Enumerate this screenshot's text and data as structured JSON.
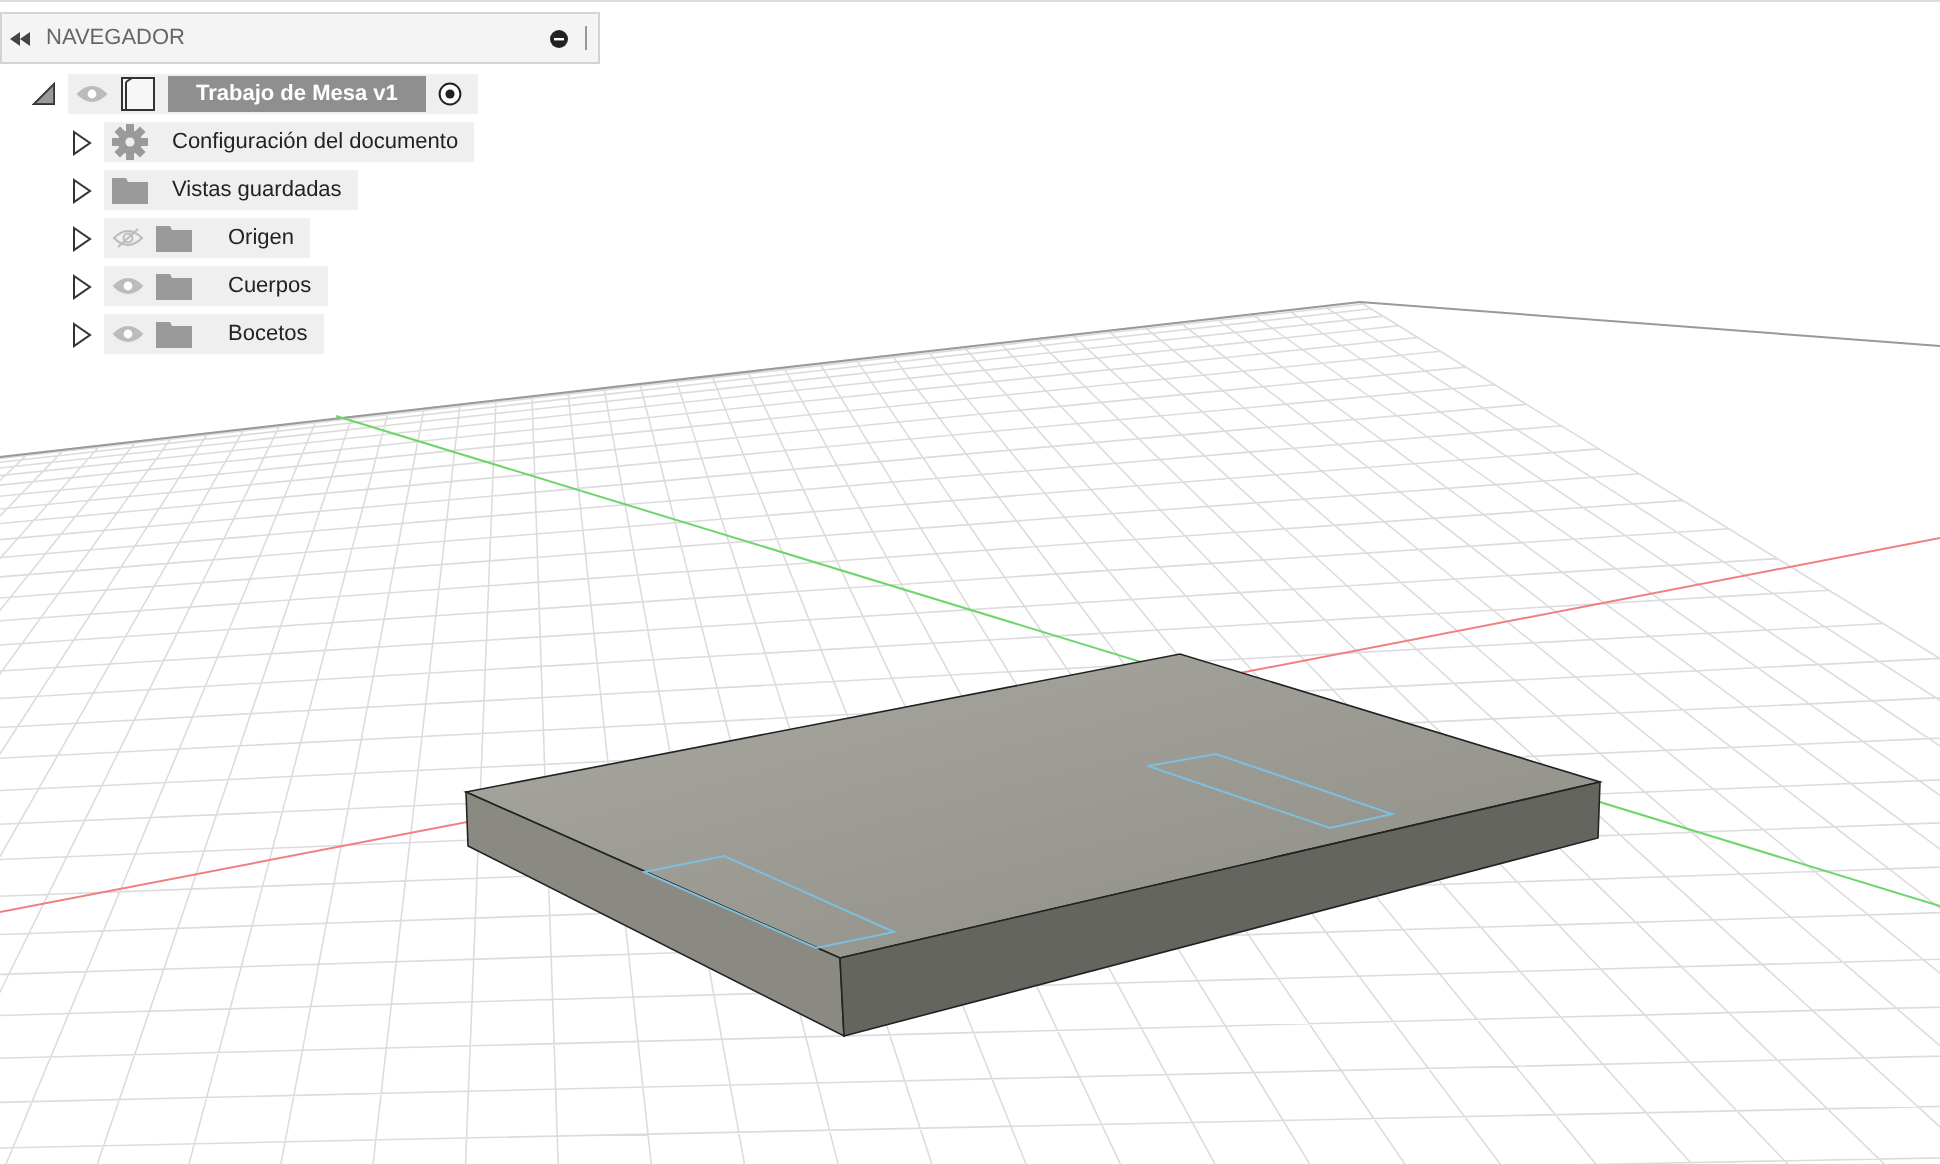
{
  "navigator": {
    "title": "NAVEGADOR",
    "root": {
      "label": "Trabajo de Mesa v1",
      "expanded": true,
      "visible": true,
      "active": true,
      "children": [
        {
          "label": "Configuración del documento",
          "kind": "settings",
          "expanded": false
        },
        {
          "label": "Vistas guardadas",
          "kind": "folder",
          "expanded": false
        },
        {
          "label": "Origen",
          "kind": "folder",
          "expanded": false,
          "visible": false
        },
        {
          "label": "Cuerpos",
          "kind": "folder",
          "expanded": false,
          "visible": true
        },
        {
          "label": "Bocetos",
          "kind": "folder",
          "expanded": false,
          "visible": true
        }
      ]
    }
  }
}
